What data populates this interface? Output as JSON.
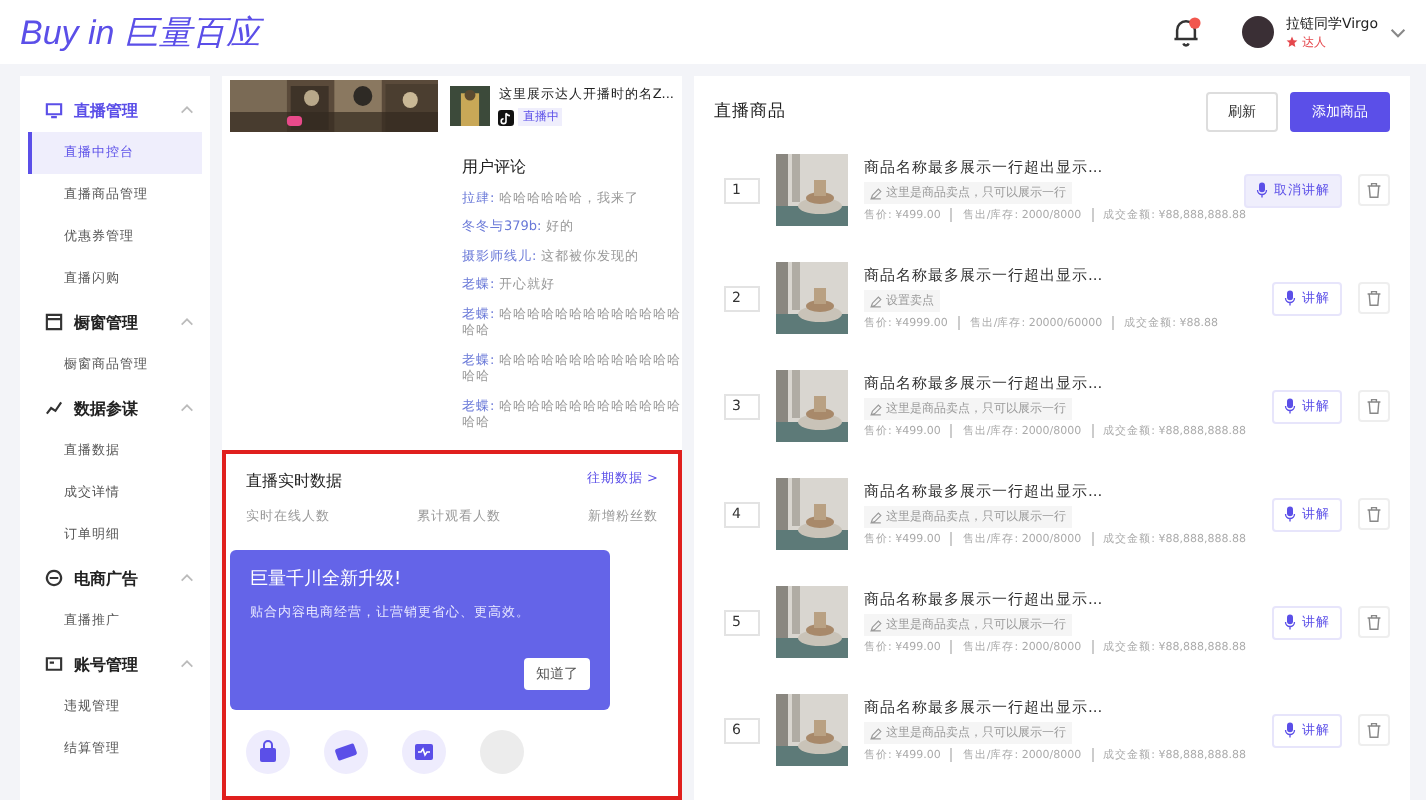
{
  "header": {
    "logo": "Buy in 巨量百应",
    "user_name": "拉链同学Virgo",
    "user_tag": "达人"
  },
  "sidebar": {
    "groups": [
      {
        "label": "直播管理",
        "expanded": true,
        "items": [
          {
            "label": "直播中控台",
            "selected": true
          },
          {
            "label": "直播商品管理",
            "selected": false
          },
          {
            "label": "优惠券管理",
            "selected": false
          },
          {
            "label": "直播闪购",
            "selected": false
          }
        ]
      },
      {
        "label": "橱窗管理",
        "expanded": true,
        "items": [
          {
            "label": "橱窗商品管理",
            "selected": false
          }
        ]
      },
      {
        "label": "数据参谋",
        "expanded": true,
        "items": [
          {
            "label": "直播数据",
            "selected": false
          },
          {
            "label": "成交详情",
            "selected": false
          },
          {
            "label": "订单明细",
            "selected": false
          }
        ]
      },
      {
        "label": "电商广告",
        "expanded": true,
        "items": [
          {
            "label": "直播推广",
            "selected": false
          }
        ]
      },
      {
        "label": "账号管理",
        "expanded": true,
        "items": [
          {
            "label": "违规管理",
            "selected": false
          },
          {
            "label": "结算管理",
            "selected": false
          }
        ]
      }
    ]
  },
  "live": {
    "title": "这里展示达人开播时的名Z...",
    "status": "直播中",
    "comments_title": "用户评论",
    "comments": [
      {
        "user": "拉肆:",
        "text": "哈哈哈哈哈哈，我来了"
      },
      {
        "user": "冬冬与379b:",
        "text": "好的"
      },
      {
        "user": "摄影师线儿:",
        "text": "这都被你发现的"
      },
      {
        "user": "老蝶:",
        "text": "开心就好"
      },
      {
        "user": "老蝶:",
        "text": "哈哈哈哈哈哈哈哈哈哈哈哈哈哈哈"
      },
      {
        "user": "老蝶:",
        "text": "哈哈哈哈哈哈哈哈哈哈哈哈哈哈哈"
      },
      {
        "user": "老蝶:",
        "text": "哈哈哈哈哈哈哈哈哈哈哈哈哈哈哈"
      }
    ]
  },
  "realtime": {
    "title": "直播实时数据",
    "link": "往期数据 >",
    "columns": [
      "实时在线人数",
      "累计观看人数",
      "新增粉丝数"
    ],
    "popup": {
      "title": "巨量千川全新升级!",
      "text": "贴合内容电商经营，让营销更省心、更高效。",
      "button": "知道了"
    },
    "tools": [
      {
        "kind": "bag"
      },
      {
        "kind": "ticket"
      },
      {
        "kind": "screen"
      },
      {
        "kind": "blank"
      }
    ]
  },
  "products": {
    "title": "直播商品",
    "refresh": "刷新",
    "add": "添加商品",
    "rows": [
      {
        "index": "1",
        "name": "商品名称最多展示一行超出显示...",
        "tag": "这里是商品卖点，只可以展示一行",
        "price": "售价: ¥499.00",
        "stock": "售出/库存: 2000/8000",
        "amount": "成交金额: ¥88,888,888.88",
        "action": "取消讲解",
        "explaining": true
      },
      {
        "index": "2",
        "name": "商品名称最多展示一行超出显示...",
        "tag": "设置卖点",
        "price": "售价: ¥4999.00",
        "stock": "售出/库存: 20000/60000",
        "amount": "成交金额: ¥88.88",
        "action": "讲解",
        "explaining": false
      },
      {
        "index": "3",
        "name": "商品名称最多展示一行超出显示...",
        "tag": "这里是商品卖点，只可以展示一行",
        "price": "售价: ¥499.00",
        "stock": "售出/库存: 2000/8000",
        "amount": "成交金额: ¥88,888,888.88",
        "action": "讲解",
        "explaining": false
      },
      {
        "index": "4",
        "name": "商品名称最多展示一行超出显示...",
        "tag": "这里是商品卖点，只可以展示一行",
        "price": "售价: ¥499.00",
        "stock": "售出/库存: 2000/8000",
        "amount": "成交金额: ¥88,888,888.88",
        "action": "讲解",
        "explaining": false
      },
      {
        "index": "5",
        "name": "商品名称最多展示一行超出显示...",
        "tag": "这里是商品卖点，只可以展示一行",
        "price": "售价: ¥499.00",
        "stock": "售出/库存: 2000/8000",
        "amount": "成交金额: ¥88,888,888.88",
        "action": "讲解",
        "explaining": false
      },
      {
        "index": "6",
        "name": "商品名称最多展示一行超出显示...",
        "tag": "这里是商品卖点，只可以展示一行",
        "price": "售价: ¥499.00",
        "stock": "售出/库存: 2000/8000",
        "amount": "成交金额: ¥88,888,888.88",
        "action": "讲解",
        "explaining": false
      }
    ]
  }
}
